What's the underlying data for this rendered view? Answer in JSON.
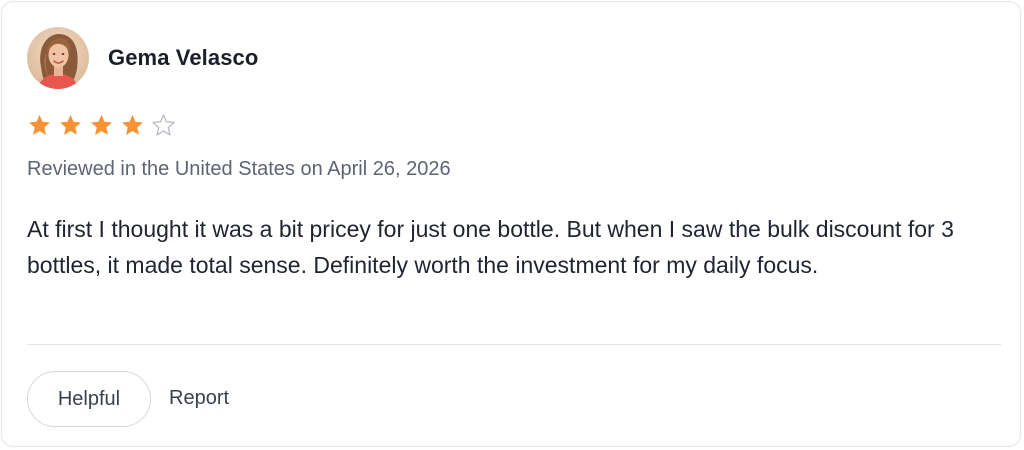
{
  "review": {
    "reviewer_name": "Gema Velasco",
    "avatar_icon": "avatar-photo",
    "rating": 4,
    "rating_max": 5,
    "star_filled_color": "#F79235",
    "star_empty_color": "#B8BCC6",
    "meta": "Reviewed in the United States on April 26, 2026",
    "body": "At first I thought it was a bit pricey for just one bottle. But when I saw the bulk discount for 3 bottles, it made total sense. Definitely worth the investment for my daily focus."
  },
  "actions": {
    "helpful_label": "Helpful",
    "report_label": "Report"
  }
}
